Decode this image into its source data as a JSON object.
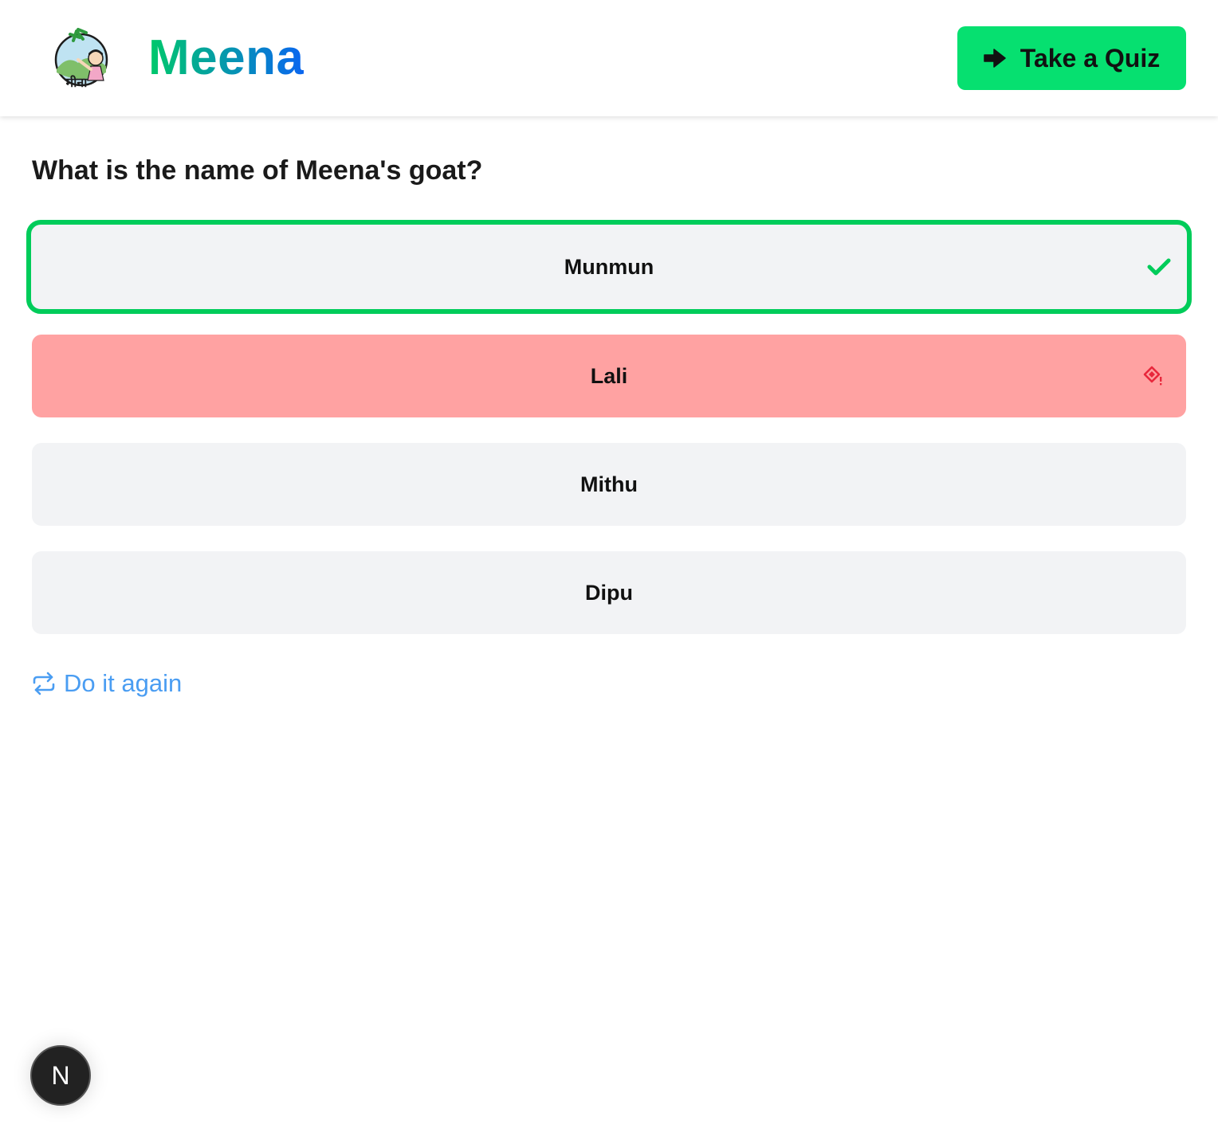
{
  "header": {
    "brand_name": "Meena",
    "logo_text": "मीना",
    "quiz_button_label": "Take a Quiz",
    "quiz_button_icon": "arrow-right-icon"
  },
  "question": {
    "text": "What is the name of Meena's goat?"
  },
  "options": [
    {
      "label": "Munmun",
      "state": "correct",
      "icon": "check-icon"
    },
    {
      "label": "Lali",
      "state": "wrong",
      "icon": "wrong-answer-icon"
    },
    {
      "label": "Mithu",
      "state": "neutral"
    },
    {
      "label": "Dipu",
      "state": "neutral"
    }
  ],
  "retry": {
    "label": "Do it again",
    "icon": "repeat-icon"
  },
  "dev_badge": {
    "letter": "N"
  },
  "colors": {
    "brand_gradient_start": "#00c96a",
    "brand_gradient_end": "#0a66f0",
    "button_green": "#06e070",
    "correct_border": "#00cc5a",
    "wrong_bg": "#ffa2a2",
    "wrong_icon": "#e8283c",
    "neutral_bg": "#f2f3f5",
    "link_blue": "#4a9df2"
  }
}
